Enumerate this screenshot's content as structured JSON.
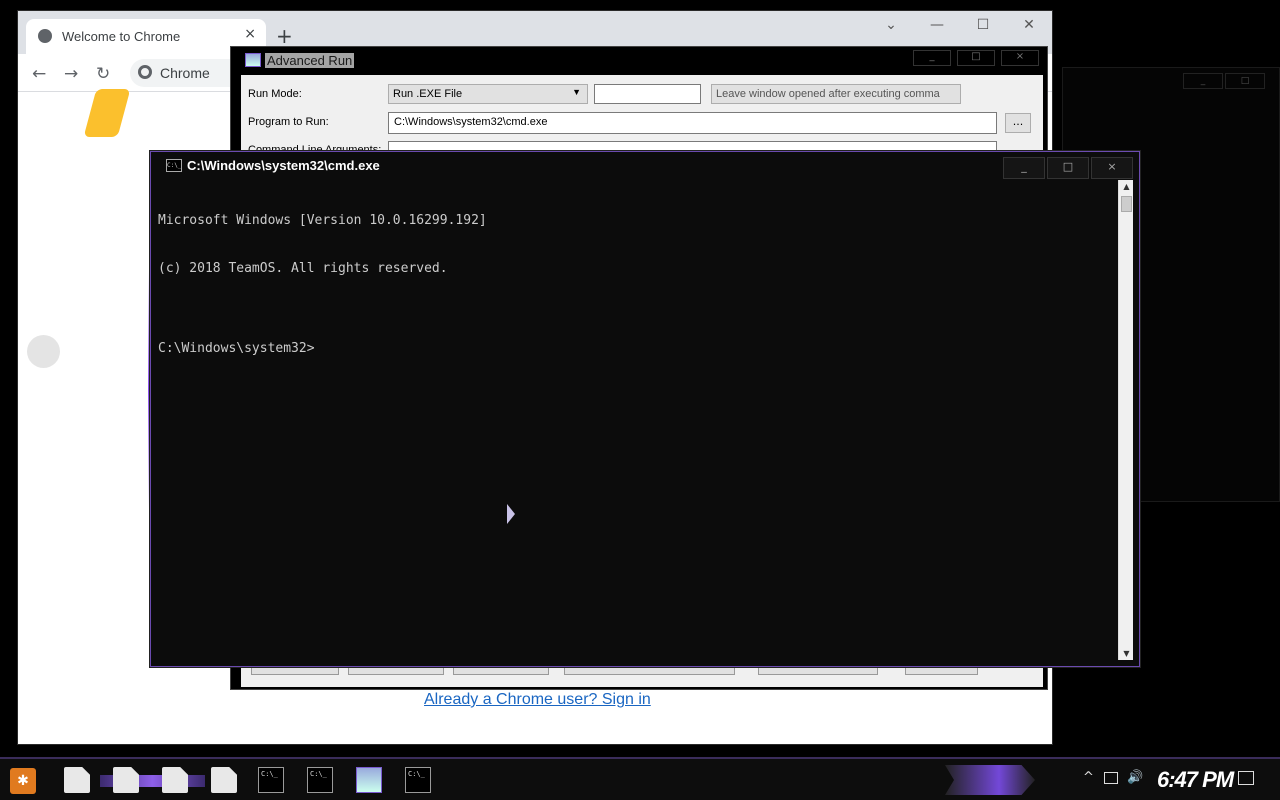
{
  "chrome": {
    "tab_title": "Welcome to Chrome",
    "tab_close": "×",
    "new_tab": "+",
    "minimize": "—",
    "maximize": "☐",
    "close": "✕",
    "chevron": "⌄",
    "back": "←",
    "forward": "→",
    "reload": "↻",
    "omnibox_text": "Chrome",
    "signin_link": "Already a Chrome user? Sign in"
  },
  "advanced_run": {
    "title": "Advanced Run",
    "run_mode_label": "Run Mode:",
    "run_mode_value": "Run .EXE File",
    "leave_open_label": "Leave window opened after executing comma",
    "program_label": "Program to Run:",
    "program_value": "C:\\Windows\\system32\\cmd.exe",
    "browse_label": "...",
    "cmdline_label": "Command Line Arguments:"
  },
  "cmd": {
    "title": "C:\\Windows\\system32\\cmd.exe",
    "icon_text": "C:\\_",
    "minimize": "_",
    "maximize": "□",
    "close": "×",
    "lines": [
      "Microsoft Windows [Version 10.0.16299.192]",
      "(c) 2018 TeamOS. All rights reserved.",
      "",
      "C:\\Windows\\system32>"
    ]
  },
  "taskbar": {
    "clock": "6:47 PM",
    "tray_up": "^",
    "network_icon": "network-icon",
    "volume_icon": "volume-icon"
  }
}
